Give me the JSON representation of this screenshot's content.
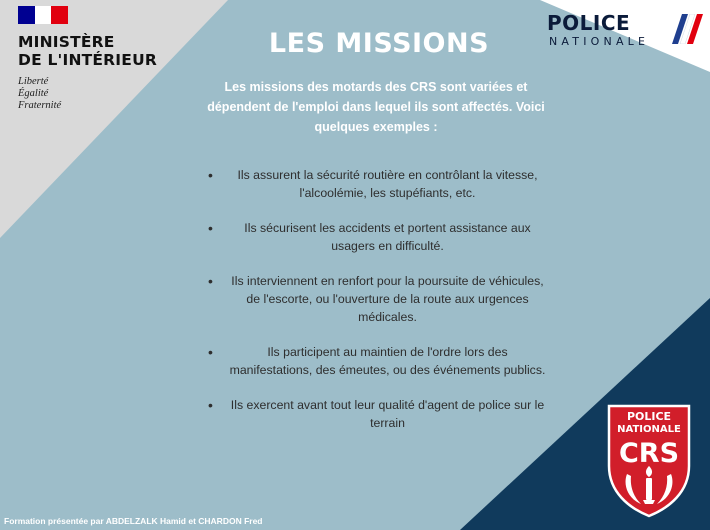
{
  "ministry": {
    "name_line1": "MINISTÈRE",
    "name_line2": "DE L'INTÉRIEUR",
    "motto": [
      "Liberté",
      "Égalité",
      "Fraternité"
    ]
  },
  "police_logo": {
    "line1": "POLICE",
    "line2": "NATIONALE"
  },
  "title": "LES MISSIONS",
  "intro": "Les missions des motards des CRS sont variées et dépendent de l'emploi dans lequel ils sont affectés. Voici quelques exemples :",
  "missions": [
    "Ils assurent la sécurité routière en contrôlant la vitesse, l'alcoolémie, les stupéfiants, etc.",
    "Ils sécurisent les accidents et portent assistance aux usagers en difficulté.",
    "Ils interviennent en renfort pour la poursuite de véhicules, de l'escorte, ou l'ouverture de la route aux urgences médicales.",
    "Ils participent au maintien de l'ordre lors des manifestations, des émeutes, ou des événements publics.",
    "Ils exercent avant tout leur qualité d'agent de police sur le terrain"
  ],
  "crs_badge": {
    "line1": "POLICE",
    "line2": "NATIONALE",
    "acronym": "CRS"
  },
  "footer": "Formation présentée par ABDELZALK Hamid et CHARDON Fred",
  "colors": {
    "background": "#9dbdc9",
    "top_left_panel": "#d9d9d9",
    "top_right_panel": "#ffffff",
    "bottom_right_panel": "#103a5c",
    "flag_blue": "#000091",
    "flag_red": "#e1000f",
    "badge_red": "#d11e2a"
  }
}
